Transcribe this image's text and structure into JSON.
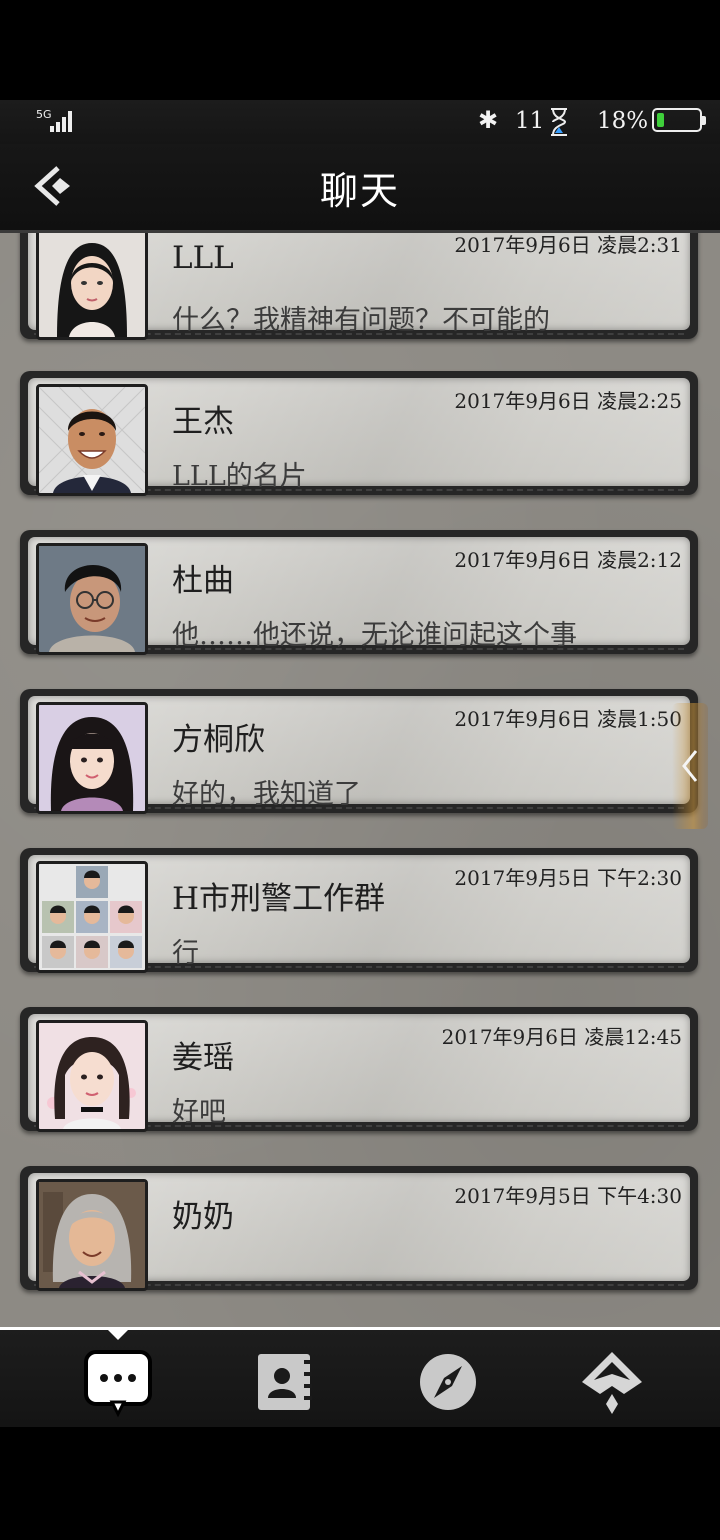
{
  "status": {
    "network": "5G",
    "time": "11",
    "battery_pct": "18%",
    "battery_level": 0.18
  },
  "header": {
    "title": "聊天"
  },
  "chats": [
    {
      "name": "LLL",
      "time": "2017年9月6日 凌晨2:31",
      "preview": "什么？我精神有问题？不可能的",
      "avatar": "woman-short-black-hair"
    },
    {
      "name": "王杰",
      "time": "2017年9月6日 凌晨2:25",
      "preview": "LLL的名片",
      "avatar": "smiling-man-suit"
    },
    {
      "name": "杜曲",
      "time": "2017年9月6日 凌晨2:12",
      "preview": "他……他还说，无论谁问起这个事",
      "avatar": "man-glasses"
    },
    {
      "name": "方桐欣",
      "time": "2017年9月6日 凌晨1:50",
      "preview": "好的，我知道了",
      "avatar": "woman-bangs"
    },
    {
      "name": "H市刑警工作群",
      "time": "2017年9月5日 下午2:30",
      "preview": "行",
      "avatar": "group-grid"
    },
    {
      "name": "姜瑶",
      "time": "2017年9月6日 凌晨12:45",
      "preview": "好吧",
      "avatar": "woman-choker"
    },
    {
      "name": "奶奶",
      "time": "2017年9月5日 下午4:30",
      "preview": "",
      "avatar": "grandmother"
    }
  ],
  "tabs": [
    {
      "icon": "chat-bubble-icon",
      "active": true
    },
    {
      "icon": "contacts-book-icon",
      "active": false
    },
    {
      "icon": "compass-icon",
      "active": false
    },
    {
      "icon": "spade-badge-icon",
      "active": false
    }
  ],
  "colors": {
    "bar": "#141414",
    "paper": "#d1d0cb",
    "background": "#8d8a84",
    "battery": "#3fcf3b"
  }
}
